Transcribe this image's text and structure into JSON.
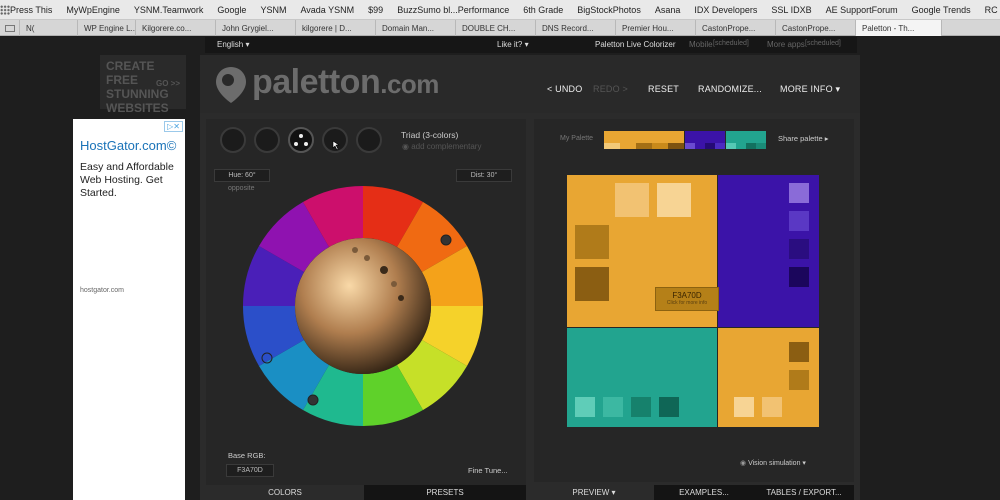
{
  "bookmarks": [
    "Press This",
    "MyWpEngine",
    "YSNM.Teamwork",
    "Google",
    "YSNM",
    "Avada YSNM",
    "$99",
    "BuzzSumo bl...Performance",
    "6th Grade",
    "BigStockPhotos",
    "Asana",
    "IDX Developers",
    "SSL IDXB",
    "AE SupportForum",
    "Google Trends",
    "RC Teamwork"
  ],
  "tabs": [
    "N(",
    "WP Engine L...",
    "Kilgorere.co...",
    "John Grygiel...",
    "kilgorere | D...",
    "Domain Man...",
    "DOUBLE CH...",
    "DNS Record...",
    "Premier Hou...",
    "CastonPrope...",
    "CastonPrope...",
    "Paletton - Th..."
  ],
  "topstrip": {
    "language": "English ▾",
    "like": "Like it? ▾",
    "live_colorizer": "Paletton Live Colorizer",
    "mobile": "Mobile",
    "mobile_tag": "[scheduled]",
    "more_apps": "More apps",
    "more_apps_tag": "[scheduled]"
  },
  "banner_ad": {
    "line1": "Create free",
    "line2": "stunning",
    "line3": "websites",
    "go": "GO >>"
  },
  "side_ad": {
    "close": "▷✕",
    "title": "HostGator.com©",
    "text": "Easy and Affordable Web Hosting. Get Started.",
    "url": "hostgator.com"
  },
  "logo": {
    "name": "paletton",
    "tld": ".com"
  },
  "menu": {
    "undo": "< UNDO",
    "redo": "REDO >",
    "reset": "RESET",
    "randomize": "RANDOMIZE...",
    "more_info": "MORE INFO ▾"
  },
  "scheme": {
    "label": "Triad (3-colors)",
    "add_complementary": "add complementary"
  },
  "hue": {
    "label": "Hue: 60°",
    "opposite": "opposite"
  },
  "dist": {
    "label": "Dist: 30°"
  },
  "base_rgb": {
    "label": "Base RGB:",
    "value": "F3A70D"
  },
  "fine_tune": "Fine Tune...",
  "palette": {
    "label": "My Palette",
    "share": "Share palette ▸"
  },
  "preview_overlay": {
    "hex": "F3A70D",
    "hint": "Click for more info"
  },
  "vision": "Vision simulation ▾",
  "bottom_tabs": {
    "colors": "COLORS",
    "presets": "PRESETS",
    "preview": "PREVIEW ▾",
    "examples": "EXAMPLES...",
    "tables": "TABLES / EXPORT..."
  },
  "colors": {
    "primary": "#e8a633",
    "secondary_a": "#3b13a8",
    "secondary_b": "#22a48f"
  }
}
